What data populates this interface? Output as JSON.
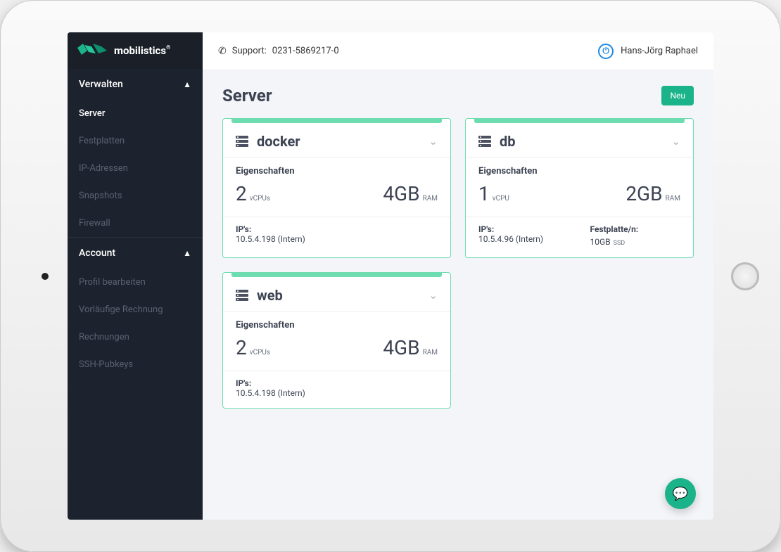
{
  "brand": {
    "name": "mobilistics"
  },
  "topbar": {
    "support_label": "Support:",
    "support_number": "0231-5869217-0",
    "user_name": "Hans-Jörg Raphael"
  },
  "sidebar": {
    "group_manage": {
      "label": "Verwalten"
    },
    "items_manage": [
      {
        "label": "Server"
      },
      {
        "label": "Festplatten"
      },
      {
        "label": "IP-Adressen"
      },
      {
        "label": "Snapshots"
      },
      {
        "label": "Firewall"
      }
    ],
    "group_account": {
      "label": "Account"
    },
    "items_account": [
      {
        "label": "Profil bearbeiten"
      },
      {
        "label": "Vorläufige Rechnung"
      },
      {
        "label": "Rechnungen"
      },
      {
        "label": "SSH-Pubkeys"
      }
    ]
  },
  "page": {
    "title": "Server",
    "new_button": "Neu",
    "props_heading": "Eigenschaften",
    "ips_label": "IP's:",
    "disk_label": "Festplatte/n:"
  },
  "servers": [
    {
      "name": "docker",
      "cpu_count": "2",
      "cpu_unit": "vCPUs",
      "ram_amount": "4GB",
      "ram_unit": "RAM",
      "ip_value": "10.5.4.198 (Intern)",
      "disk_value": "",
      "disk_unit": ""
    },
    {
      "name": "db",
      "cpu_count": "1",
      "cpu_unit": "vCPU",
      "ram_amount": "2GB",
      "ram_unit": "RAM",
      "ip_value": "10.5.4.96 (Intern)",
      "disk_value": "10GB",
      "disk_unit": "SSD"
    },
    {
      "name": "web",
      "cpu_count": "2",
      "cpu_unit": "vCPUs",
      "ram_amount": "4GB",
      "ram_unit": "RAM",
      "ip_value": "10.5.4.198 (Intern)",
      "disk_value": "",
      "disk_unit": ""
    }
  ]
}
